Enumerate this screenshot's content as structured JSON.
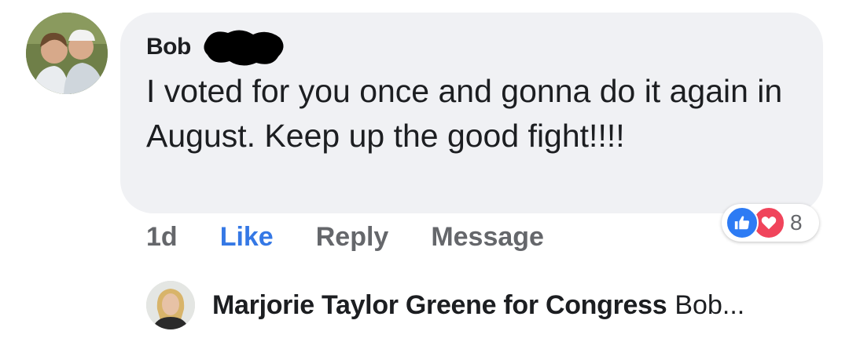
{
  "comment": {
    "author": "Bob",
    "text": "I voted for you once and gonna do it again in August. Keep up the good fight!!!!"
  },
  "actions": {
    "time": "1d",
    "like": "Like",
    "reply": "Reply",
    "message": "Message"
  },
  "reactions": {
    "icons": [
      "like-icon",
      "love-icon"
    ],
    "count": "8",
    "colors": {
      "like": "#2d7bf4",
      "love": "#f0445b"
    }
  },
  "reply": {
    "author": "Marjorie Taylor Greene for Congress",
    "snippet": "Bob..."
  },
  "colors": {
    "bubble": "#f0f1f4",
    "link": "#3578e5",
    "muted": "#65676b",
    "text": "#1c1e21"
  }
}
